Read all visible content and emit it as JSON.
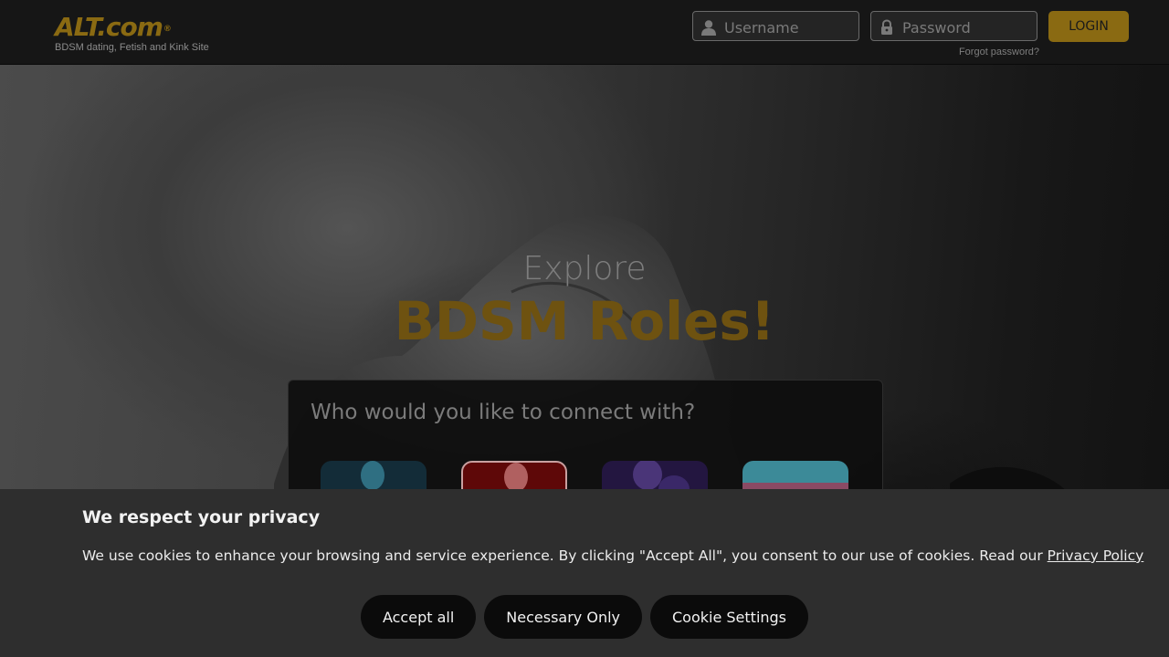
{
  "header": {
    "logo_text": "ALT.com",
    "logo_mark": "®",
    "tagline": "BDSM dating, Fetish and Kink Site",
    "username_placeholder": "Username",
    "password_placeholder": "Password",
    "login_label": "LOGIN",
    "forgot_label": "Forgot password?",
    "accent_color": "#8a6a12"
  },
  "hero": {
    "line1": "Explore",
    "line2": "BDSM Roles!",
    "connect_title": "Who would you like to connect with?",
    "role_tiles": [
      {
        "icon": "man-icon",
        "color": "#163a4a"
      },
      {
        "icon": "woman-icon",
        "color": "#6a0a0a",
        "selected": true
      },
      {
        "icon": "couple-icon",
        "color": "#2a1a4e"
      },
      {
        "icon": "trans-flag-icon",
        "color": "#3a8a9a"
      }
    ]
  },
  "cookie": {
    "title": "We respect your privacy",
    "text": "We use cookies to enhance your browsing and service experience. By clicking \"Accept All\", you consent to our use of cookies. Read our ",
    "link": "Privacy Policy",
    "accept_all": "Accept all",
    "necessary_only": "Necessary Only",
    "settings": "Cookie Settings"
  }
}
